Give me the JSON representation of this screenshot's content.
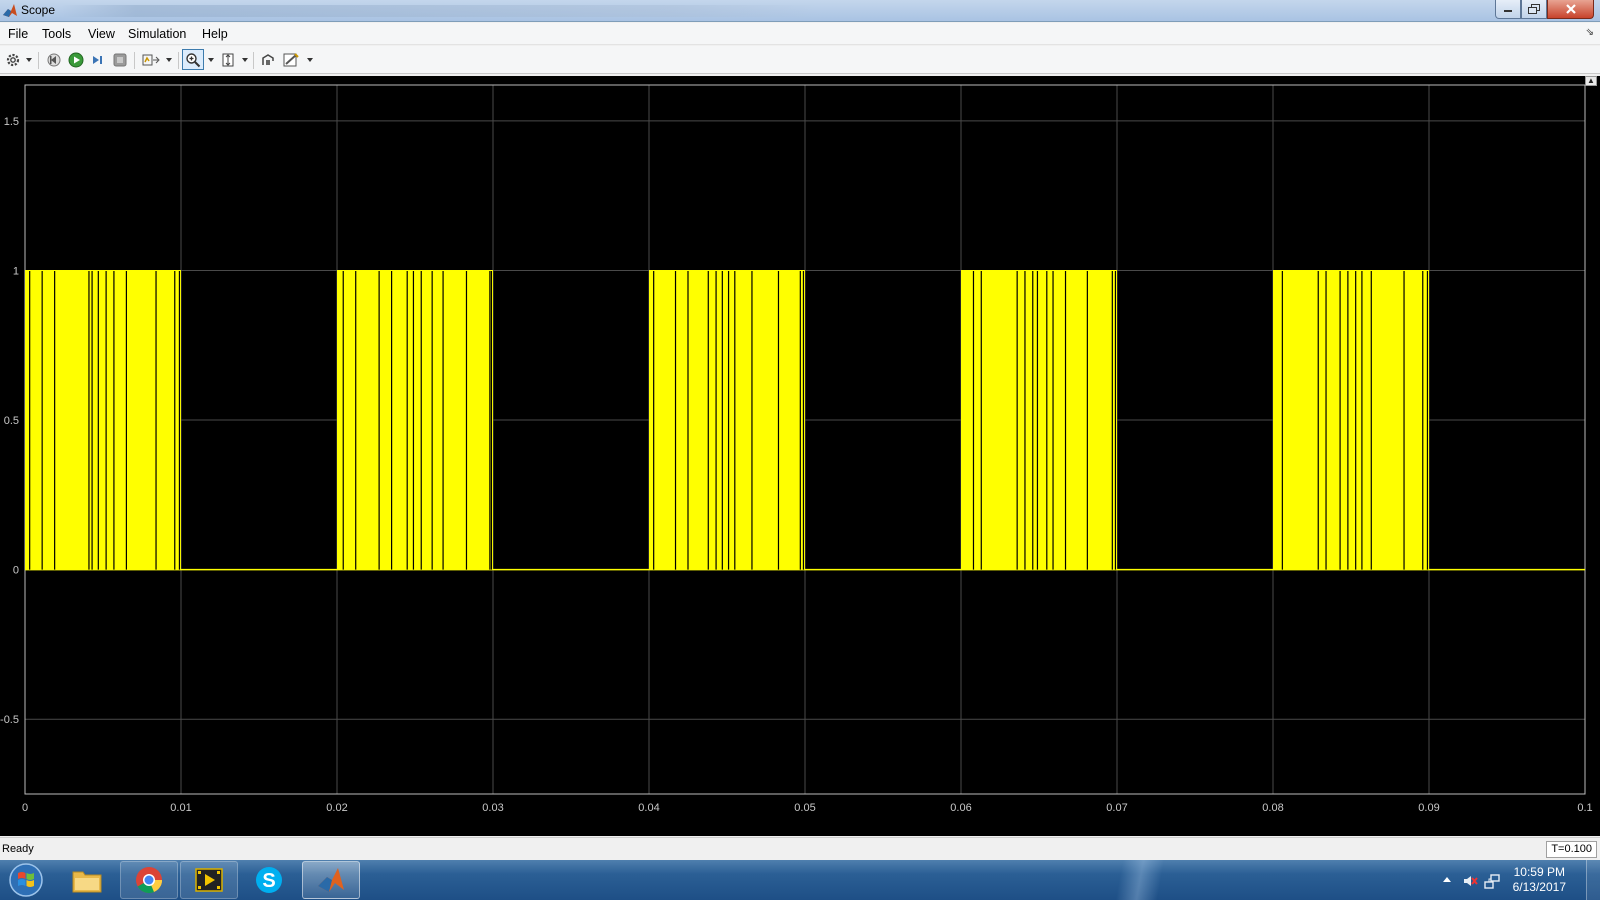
{
  "window": {
    "title": "Scope"
  },
  "menu": {
    "items": [
      "File",
      "Tools",
      "View",
      "Simulation",
      "Help"
    ]
  },
  "toolbar": {
    "icons": [
      "settings-icon",
      "step-back-icon",
      "run-icon",
      "step-forward-icon",
      "stop-icon",
      "signal-select-icon",
      "zoom-in-icon",
      "scale-axes-icon",
      "highlight-simulink-block-icon",
      "draw-style-icon"
    ]
  },
  "status": {
    "text": "Ready",
    "time": "T=0.100"
  },
  "taskbar": {
    "clock_time": "10:59 PM",
    "clock_date": "6/13/2017",
    "apps": [
      "windows-explorer-icon",
      "chrome-icon",
      "video-app-icon",
      "skype-icon",
      "matlab-icon"
    ]
  },
  "colors": {
    "signal": "#ffff00",
    "grid": "#4a4a4a",
    "plot_background": "#000000",
    "tick_text": "#c8c8c8"
  },
  "chart_data": {
    "type": "line",
    "title": "",
    "xlabel": "",
    "ylabel": "",
    "xlim": [
      0,
      0.1
    ],
    "ylim": [
      -0.75,
      1.62
    ],
    "x_ticks": [
      0,
      0.01,
      0.02,
      0.03,
      0.04,
      0.05,
      0.06,
      0.07,
      0.08,
      0.09,
      0.1
    ],
    "x_tick_labels": [
      "0",
      "0.01",
      "0.02",
      "0.03",
      "0.04",
      "0.05",
      "0.06",
      "0.07",
      "0.08",
      "0.09",
      "0.1"
    ],
    "y_ticks": [
      -0.5,
      0,
      0.5,
      1,
      1.5
    ],
    "y_tick_labels": [
      "-0.5",
      "0",
      "0.5",
      "1",
      "1.5"
    ],
    "grid": true,
    "series": [
      {
        "description": "PWM pulse train switching between 0 and 1; dense high-frequency switching during 0-0.01, 0.02-0.03, 0.04-0.05, 0.06-0.07, 0.08-0.09, and low (0) otherwise",
        "bursts": [
          [
            0,
            0.01
          ],
          [
            0.02,
            0.03
          ],
          [
            0.04,
            0.05
          ],
          [
            0.06,
            0.07
          ],
          [
            0.08,
            0.09
          ]
        ],
        "low_value": 0,
        "high_value": 1,
        "low_notches": [
          [
            0.0003,
            0.0011,
            0.0019,
            0.0041,
            0.0043,
            0.0047,
            0.0052,
            0.0057,
            0.0065,
            0.0084,
            0.0096,
            0.0099
          ],
          [
            0.0204,
            0.0212,
            0.0227,
            0.0235,
            0.0245,
            0.0249,
            0.0254,
            0.0261,
            0.0268,
            0.0283,
            0.0298,
            0.0299
          ],
          [
            0.0403,
            0.0417,
            0.0425,
            0.0438,
            0.0443,
            0.0447,
            0.0451,
            0.0455,
            0.0466,
            0.0483,
            0.0497,
            0.0499
          ],
          [
            0.0608,
            0.0613,
            0.0636,
            0.0641,
            0.0646,
            0.0649,
            0.0655,
            0.0659,
            0.0667,
            0.0681,
            0.0697,
            0.0699
          ],
          [
            0.0806,
            0.0829,
            0.0834,
            0.0843,
            0.0848,
            0.0853,
            0.0857,
            0.0863,
            0.0884,
            0.0896,
            0.0899
          ]
        ]
      }
    ]
  }
}
